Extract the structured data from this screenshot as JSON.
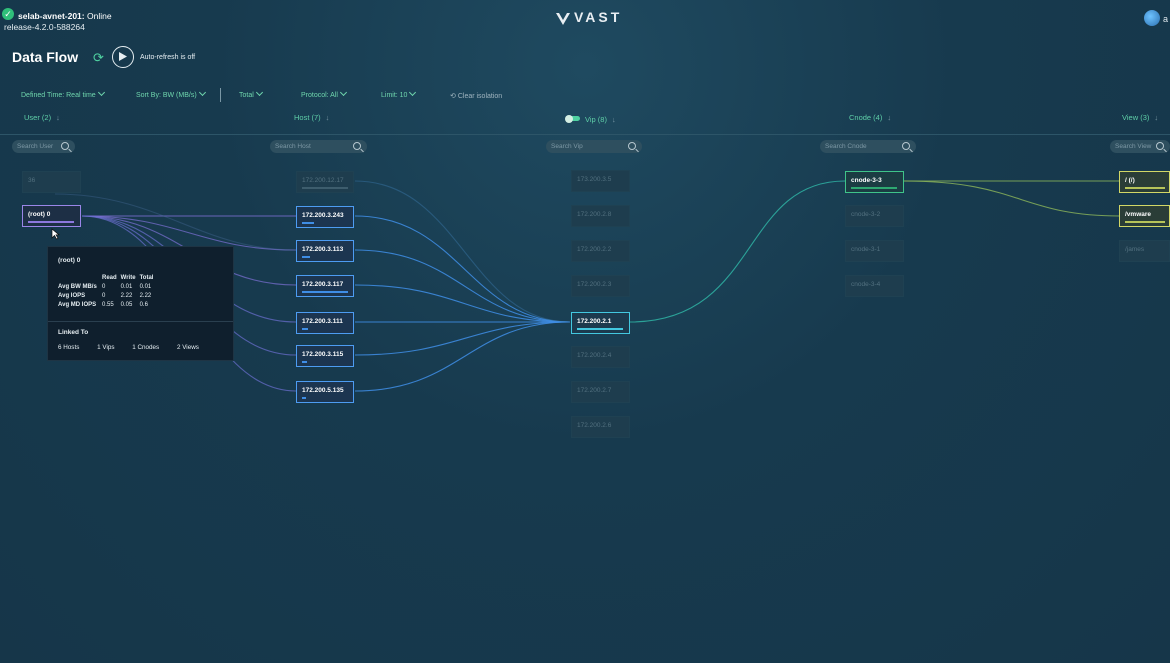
{
  "cluster": {
    "name": "selab-avnet-201",
    "status": "Online",
    "release": "release-4.2.0-588264"
  },
  "brand": {
    "logo": "VAST"
  },
  "user": {
    "initials": "a"
  },
  "page": {
    "title": "Data Flow",
    "autorefresh": "Auto-refresh is off"
  },
  "toolbar": {
    "defined_time": "Defined Time: Real time",
    "sort_by": "Sort By: BW (MB/s)",
    "total": "Total",
    "protocol": "Protocol: All",
    "limit": "Limit: 10",
    "clear_isolation": "Clear isolation"
  },
  "columns": {
    "user": {
      "label": "User (2)",
      "search": "Search User"
    },
    "host": {
      "label": "Host (7)",
      "search": "Search Host"
    },
    "vip": {
      "label": "Vip (8)",
      "search": "Search Vip"
    },
    "cnode": {
      "label": "Cnode (4)",
      "search": "Search Cnode"
    },
    "view": {
      "label": "View (3)",
      "search": "Search View"
    }
  },
  "nodes": {
    "users": [
      "36",
      "(root) 0"
    ],
    "hosts": [
      "172.200.12.17",
      "172.200.3.243",
      "172.200.3.113",
      "172.200.3.117",
      "172.200.3.111",
      "172.200.3.115",
      "172.200.5.135"
    ],
    "vips": [
      "173.200.3.5",
      "172.200.2.8",
      "172.200.2.2",
      "172.200.2.3",
      "172.200.2.1",
      "172.200.2.4",
      "172.200.2.7",
      "172.200.2.6"
    ],
    "cnodes": [
      "cnode-3-3",
      "cnode-3-2",
      "cnode-3-1",
      "cnode-3-4"
    ],
    "views": [
      "/ (/)",
      "/vmware",
      "/james"
    ]
  },
  "tooltip": {
    "title": "(root) 0",
    "headers": [
      "Read",
      "Write",
      "Total"
    ],
    "rows": [
      {
        "label": "Avg BW MB/s",
        "read": "0",
        "write": "0.01",
        "total": "0.01"
      },
      {
        "label": "Avg IOPS",
        "read": "0",
        "write": "2.22",
        "total": "2.22"
      },
      {
        "label": "Avg MD IOPS",
        "read": "0.55",
        "write": "0.05",
        "total": "0.6"
      }
    ],
    "linked_to": "Linked To",
    "links": [
      "6  Hosts",
      "1  Vips",
      "1  Cnodes",
      "2  Views"
    ]
  },
  "colors": {
    "accent": "#4fd1a1",
    "user_sel": "#9a86e8",
    "host_sel": "#4d9cf2",
    "vip_sel": "#43c8e0",
    "cnode_sel": "#3fc48a",
    "view_sel": "#d2d766"
  }
}
